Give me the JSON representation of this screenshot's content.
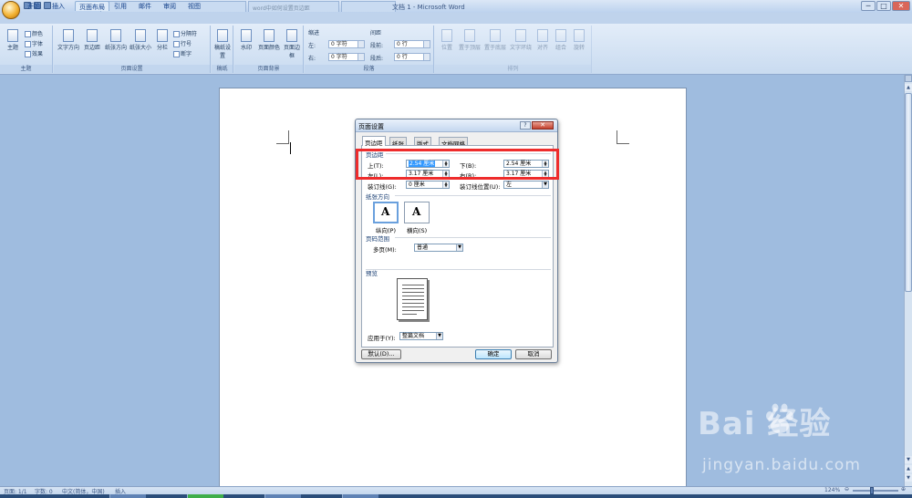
{
  "window": {
    "title": "文档 1 - Microsoft Word",
    "background_tabs": [
      "",
      "word中如何设置页边距",
      "",
      "",
      ""
    ],
    "controls": [
      "─",
      "□",
      "✕"
    ]
  },
  "ribbon": {
    "tabs": [
      "开始",
      "插入",
      "页面布局",
      "引用",
      "邮件",
      "审阅",
      "视图"
    ],
    "active_tab": "页面布局",
    "groups": {
      "theme": {
        "label": "主题",
        "button": "主题",
        "items": [
          "颜色",
          "字体",
          "效果"
        ]
      },
      "page_setup": {
        "label": "页面设置",
        "buttons": [
          "文字方向",
          "页边距",
          "纸张方向",
          "纸张大小",
          "分栏"
        ],
        "small": [
          "分隔符",
          "行号",
          "断字"
        ]
      },
      "draft": {
        "label": "稿纸",
        "button": "稿纸设置"
      },
      "background": {
        "label": "页面背景",
        "buttons": [
          "水印",
          "页面颜色",
          "页面边框"
        ]
      },
      "paragraph": {
        "label": "段落",
        "indent_title": "缩进",
        "spacing_title": "间距",
        "indent_left_label": "左:",
        "indent_left": "0 字符",
        "indent_right_label": "右:",
        "indent_right": "0 字符",
        "space_before_label": "段前:",
        "space_before": "0 行",
        "space_after_label": "段后:",
        "space_after": "0 行"
      },
      "arrange": {
        "label": "排列",
        "buttons": [
          "位置",
          "置于顶层",
          "置于底层",
          "文字环绕",
          "对齐",
          "组合",
          "旋转"
        ]
      }
    }
  },
  "dialog": {
    "title": "页面设置",
    "help": "?",
    "close": "✕",
    "tabs": [
      "页边距",
      "纸张",
      "版式",
      "文档网格"
    ],
    "active_tab": "页边距",
    "margins_section": "页边距",
    "top_label": "上(T):",
    "top_value": "2.54 厘米",
    "bottom_label": "下(B):",
    "bottom_value": "2.54 厘米",
    "left_label": "左(L):",
    "left_value": "3.17 厘米",
    "right_label": "右(R):",
    "right_value": "3.17 厘米",
    "gutter_label": "装订线(G):",
    "gutter_value": "0 厘米",
    "gutter_pos_label": "装订线位置(U):",
    "gutter_pos_value": "左",
    "orientation_section": "纸张方向",
    "portrait_label": "纵向(P)",
    "landscape_label": "横向(S)",
    "orientation_glyph": "A",
    "pages_section": "页码范围",
    "multiple_pages_label": "多页(M):",
    "multiple_pages_value": "普通",
    "preview_section": "预览",
    "apply_label": "应用于(Y):",
    "apply_value": "整篇文档",
    "default_button": "默认(D)...",
    "ok_button": "确定",
    "cancel_button": "取消"
  },
  "statusbar": {
    "page": "页面: 1/1",
    "words": "字数: 0",
    "language": "中文(简体，中国)",
    "mode": "插入",
    "zoom": "124%",
    "zoom_minus": "⊖",
    "zoom_plus": "⊕"
  },
  "watermark": {
    "brand": "Bai  经验",
    "url": "jingyan.baidu.com"
  },
  "colors": {
    "highlight": "#ee2c2c",
    "ribbon": "#dbe7f6",
    "workspace": "#9fbcdf"
  }
}
